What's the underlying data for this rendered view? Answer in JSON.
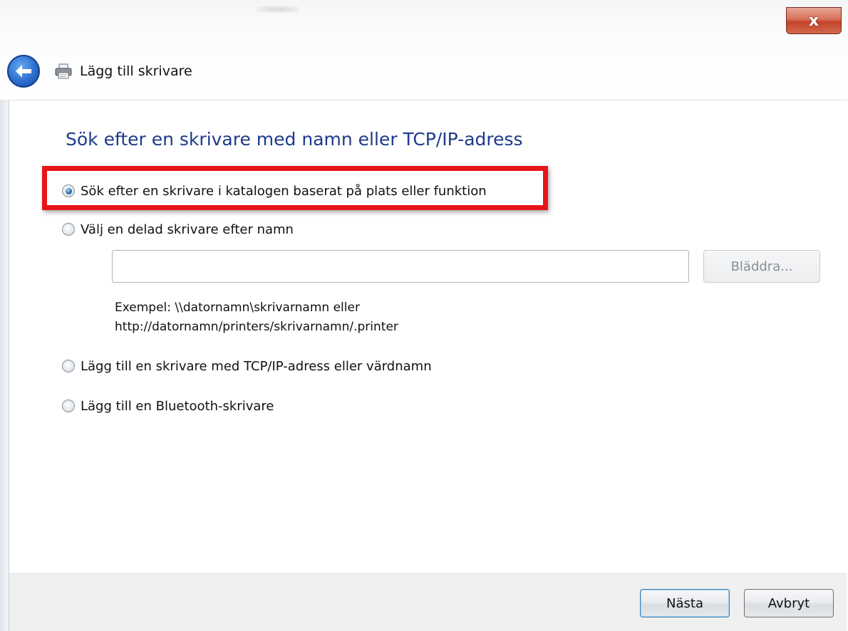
{
  "window": {
    "title": "Lägg till skrivare",
    "close_glyph": "x",
    "close_icon": "close-icon",
    "back_icon": "back-arrow-icon",
    "printer_icon": "printer-icon"
  },
  "heading": "Sök efter en skrivare med namn eller TCP/IP-adress",
  "options": [
    {
      "label": "Sök efter en skrivare i katalogen baserat på plats eller funktion",
      "selected": true
    },
    {
      "label": "Välj en delad skrivare efter namn",
      "selected": false
    },
    {
      "label": "Lägg till en skrivare med TCP/IP-adress eller värdnamn",
      "selected": false
    },
    {
      "label": "Lägg till en Bluetooth-skrivare",
      "selected": false
    }
  ],
  "shared_printer": {
    "input_value": "",
    "browse_label": "Bläddra...",
    "example_line1": "Exempel: \\\\datornamn\\skrivarnamn eller",
    "example_line2": "http://datornamn/printers/skrivarnamn/.printer"
  },
  "footer": {
    "next_label": "Nästa",
    "cancel_label": "Avbryt"
  },
  "colors": {
    "heading": "#1e3a8a",
    "highlight_border": "#e8141b",
    "close_button": "#c2442a",
    "back_button": "#2d6fd0"
  }
}
